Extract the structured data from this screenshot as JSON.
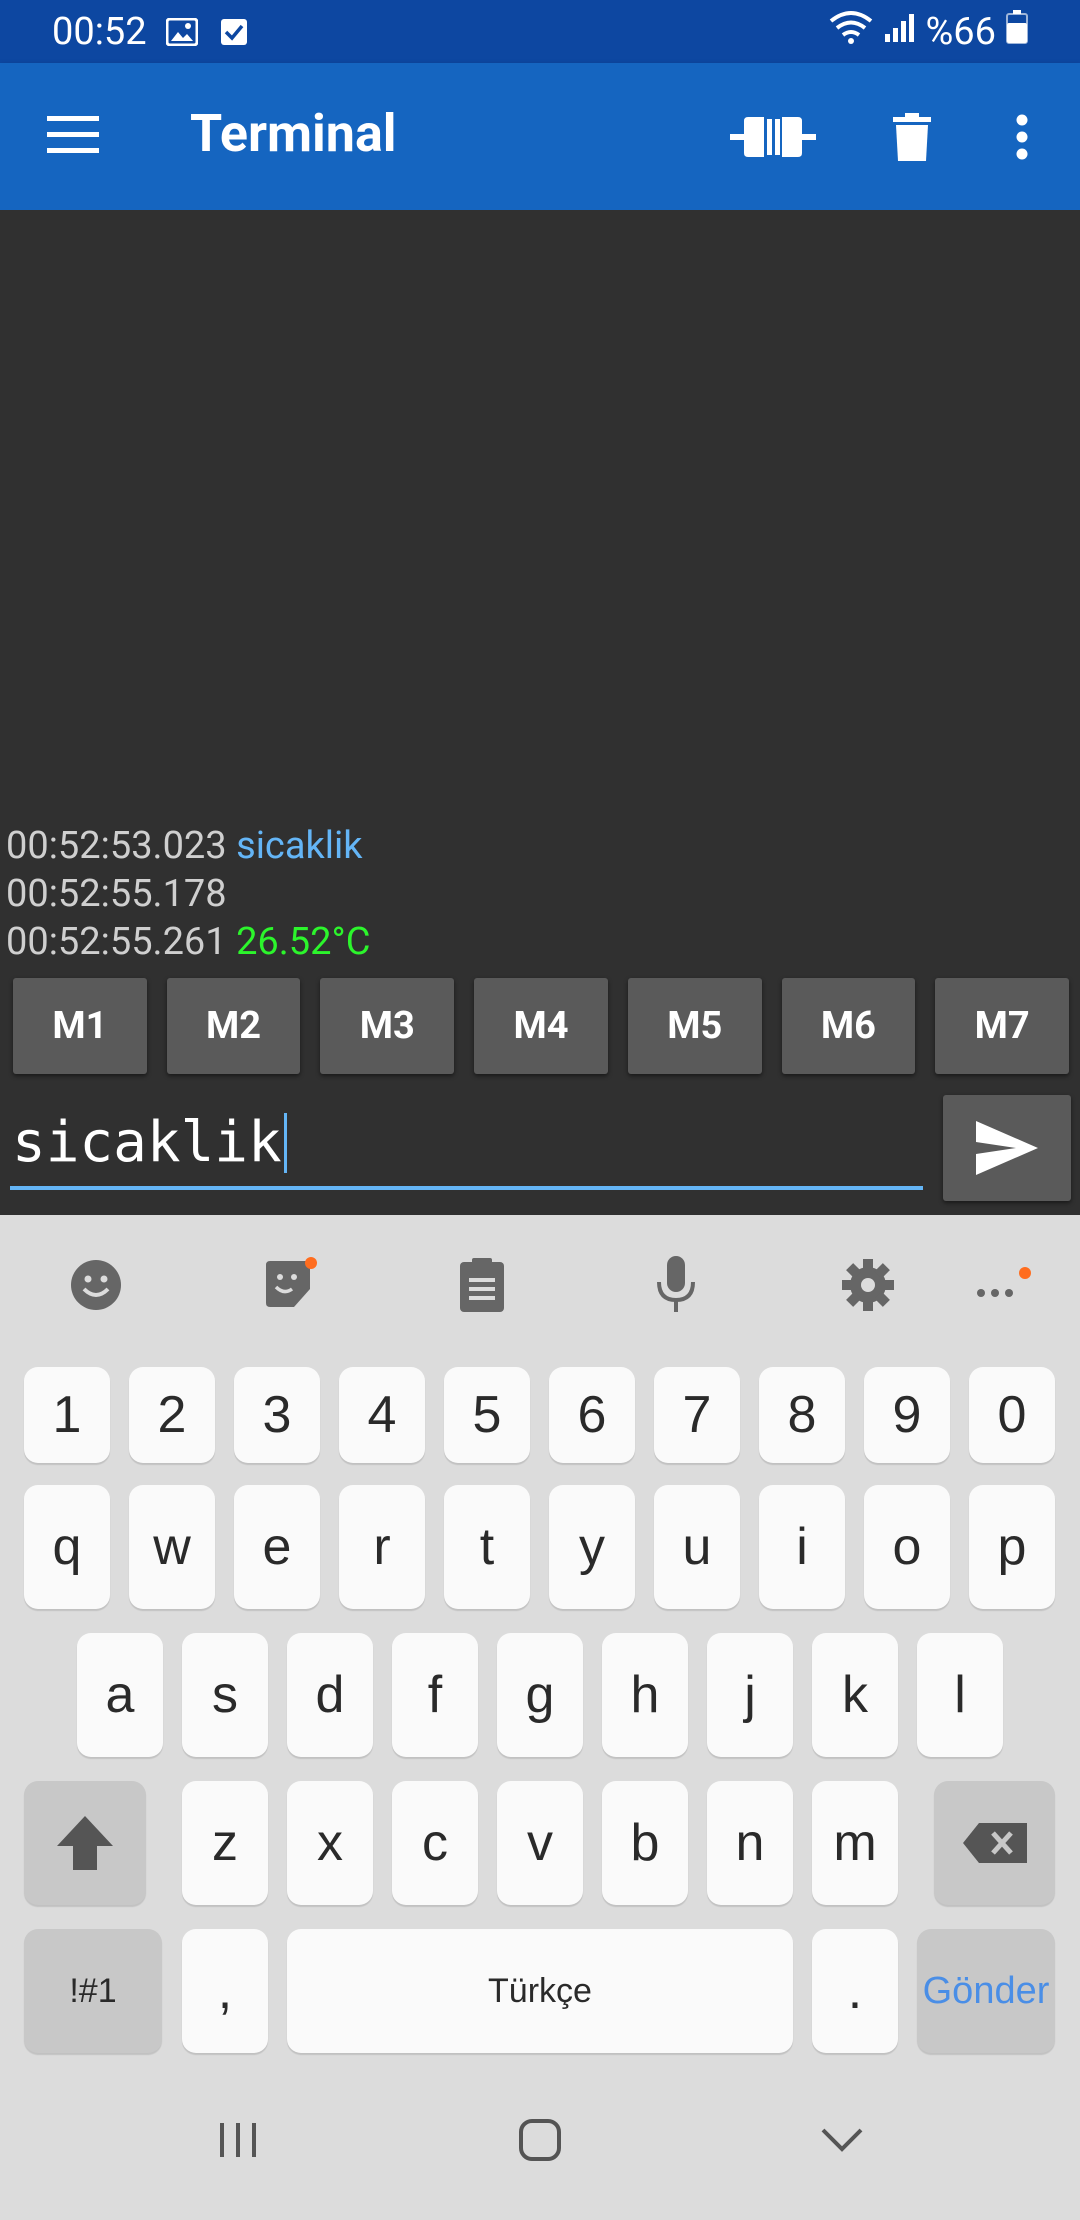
{
  "status_bar": {
    "time": "00:52",
    "battery": "%66"
  },
  "app_bar": {
    "title": "Terminal"
  },
  "terminal": {
    "lines": [
      {
        "time": "00:52:53.023",
        "text": "sicaklik",
        "kind": "sent"
      },
      {
        "time": "00:52:55.178",
        "text": "",
        "kind": "received"
      },
      {
        "time": "00:52:55.261",
        "text": "26.52°C",
        "kind": "received"
      }
    ],
    "colors": {
      "sent": "#64b5f6",
      "received": "#2cf52c",
      "timestamp": "#cfcfcf",
      "background": "#303030"
    }
  },
  "macros": [
    "M1",
    "M2",
    "M3",
    "M4",
    "M5",
    "M6",
    "M7"
  ],
  "input": {
    "value": "sicaklik"
  },
  "keyboard": {
    "number_row": [
      "1",
      "2",
      "3",
      "4",
      "5",
      "6",
      "7",
      "8",
      "9",
      "0"
    ],
    "row1": [
      "q",
      "w",
      "e",
      "r",
      "t",
      "y",
      "u",
      "i",
      "o",
      "p"
    ],
    "row2": [
      "a",
      "s",
      "d",
      "f",
      "g",
      "h",
      "j",
      "k",
      "l"
    ],
    "row3": [
      "z",
      "x",
      "c",
      "v",
      "b",
      "n",
      "m"
    ],
    "symbols_label": "!#1",
    "comma": ",",
    "space_label": "Türkçe",
    "period": ".",
    "enter_label": "Gönder"
  },
  "colors": {
    "status_bar": "#0d47a1",
    "app_bar": "#1565c0",
    "accent": "#64b5f6"
  }
}
